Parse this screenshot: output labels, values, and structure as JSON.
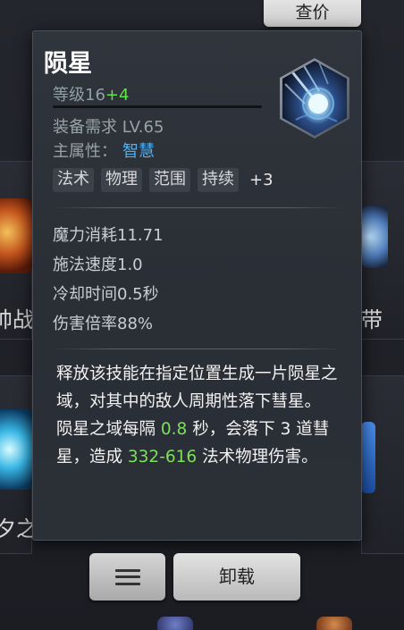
{
  "header": {
    "price_check_label": "查价"
  },
  "background": {
    "left_label_1": "帅战",
    "left_label_2": "夕之",
    "right_label_1": "带"
  },
  "tooltip": {
    "title": "陨星",
    "level_label": "等级16",
    "level_bonus": "+4",
    "requirement": "装备需求 LV.65",
    "main_attr_label": "主属性：",
    "main_attr_value": "智慧",
    "tags": [
      "法术",
      "物理",
      "范围",
      "持续"
    ],
    "tags_more": "+3",
    "skill_icon": "meteor-skill-icon",
    "stats": [
      "魔力消耗11.71",
      "施法速度1.0",
      "冷却时间0.5秒",
      "伤害倍率88%"
    ],
    "description": {
      "line1": "释放该技能在指定位置生成一片陨星之域，对其中的敌人周期性落下彗星。",
      "line2_pre": "陨星之域每隔 ",
      "line2_interval": "0.8",
      "line2_mid": " 秒，会落下 3 道彗星，造成 ",
      "line2_damage": "332-616",
      "line2_post": " 法术物理伤害。"
    }
  },
  "footer": {
    "menu_icon": "hamburger-icon",
    "unload_label": "卸载"
  },
  "colors": {
    "accent_green": "#63e04a",
    "attr_blue": "#4fb0f0",
    "panel_bg": "#2c3037"
  }
}
